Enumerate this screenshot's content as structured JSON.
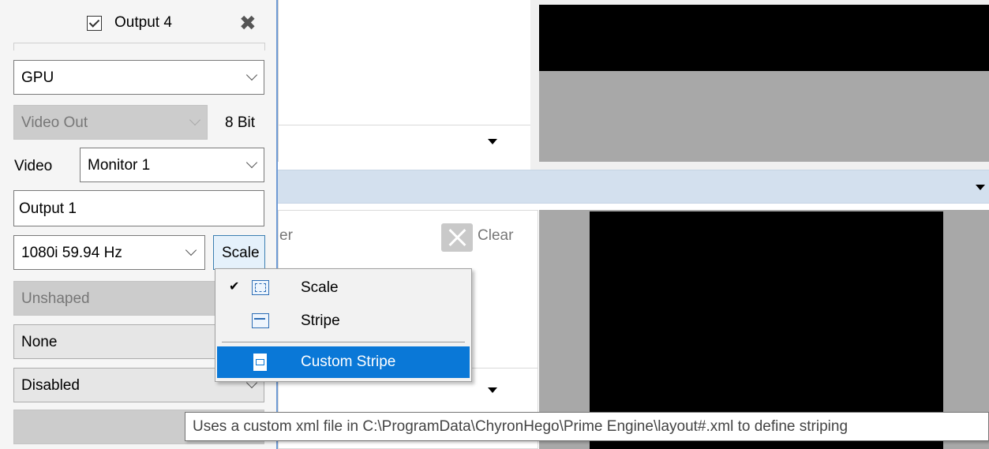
{
  "panel": {
    "title": "Output 4",
    "title_checked": true,
    "gpu_select": {
      "value": "GPU"
    },
    "video_out_select": {
      "value": "Video Out",
      "disabled": true
    },
    "bit_depth_label": "8 Bit",
    "video_label": "Video",
    "monitor_select": {
      "value": "Monitor 1"
    },
    "output_name_input": {
      "value": "Output 1"
    },
    "format_select": {
      "value": "1080i 59.94 Hz"
    },
    "scale_button_label": "Scale",
    "unshaped_select": {
      "value": "Unshaped",
      "disabled": true
    },
    "none_select": {
      "value": "None"
    },
    "disabled_select": {
      "value": "Disabled"
    }
  },
  "scale_menu": {
    "items": [
      {
        "label": "Scale",
        "checked": true,
        "icon": "scale-icon"
      },
      {
        "label": "Stripe",
        "checked": false,
        "icon": "stripe-icon"
      },
      {
        "label": "Custom Stripe",
        "checked": false,
        "highlighted": true,
        "icon": "document-icon"
      }
    ]
  },
  "tooltip": {
    "text": "Uses a custom xml file in C:\\ProgramData\\ChyronHego\\Prime Engine\\layout#.xml to define striping"
  },
  "background": {
    "clear_button_label": "Clear",
    "partial_label": "er"
  },
  "colors": {
    "accent_blue": "#0a78d7",
    "panel_border": "#6f9ad4",
    "band_blue": "#d3e0ee"
  }
}
